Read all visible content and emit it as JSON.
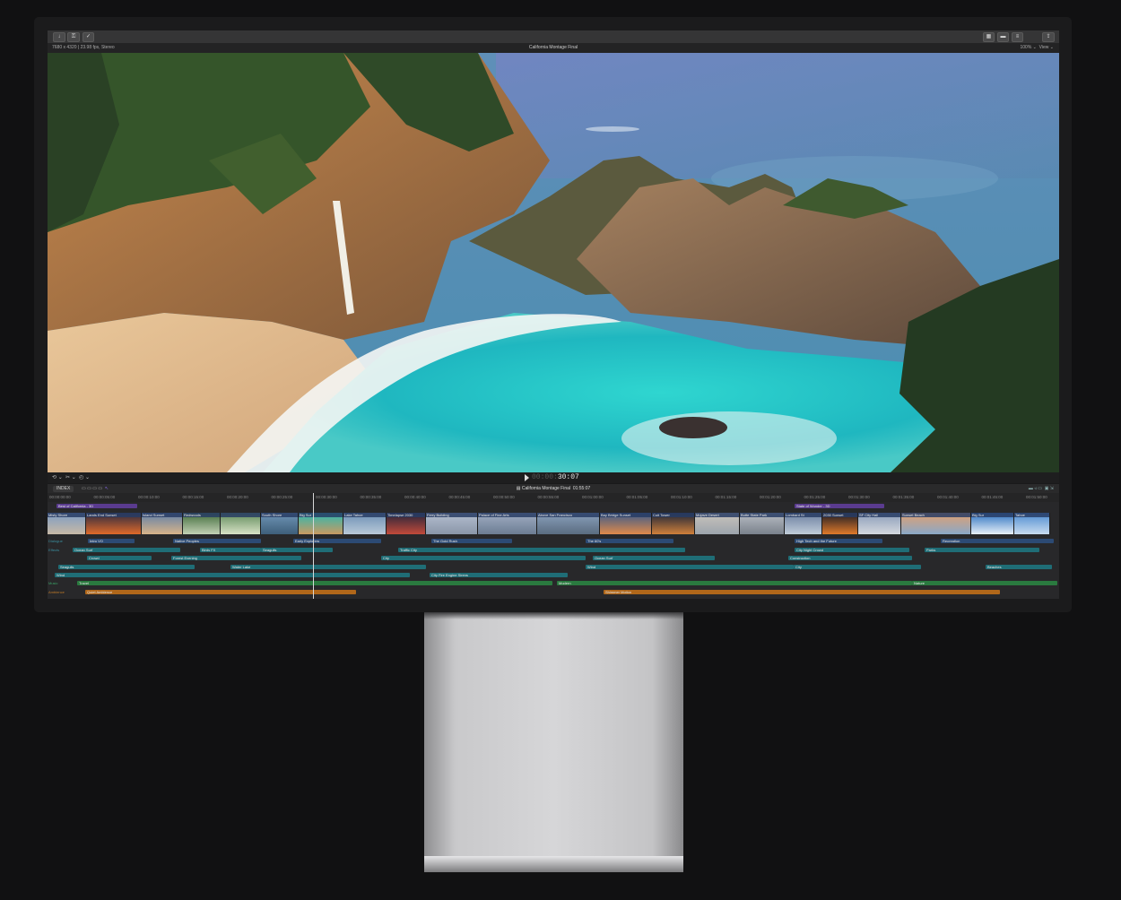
{
  "toolbar": {
    "import_icon": "download-icon",
    "keywords_icon": "key-icon",
    "background_tasks_icon": "checkmark-circle-icon",
    "share_icon": "share-icon"
  },
  "viewer": {
    "format_info": "7680 x 4320 | 23.98 fps, Stereo",
    "project_title": "California Montage Final",
    "zoom": "100%",
    "view_menu": "View"
  },
  "transport": {
    "timecode_dim": "00:00:",
    "timecode": "30:07"
  },
  "timeline": {
    "index_label": "INDEX",
    "project_label": "California Montage Final",
    "duration": "01:55:07",
    "ruler_ticks": [
      "00:00:00:00",
      "00:00:05:00",
      "00:00:10:00",
      "00:00:15:00",
      "00:00:20:00",
      "00:00:25:00",
      "00:00:30:00",
      "00:00:35:00",
      "00:00:40:00",
      "00:00:45:00",
      "00:00:50:00",
      "00:00:55:00",
      "00:01:00:00",
      "00:01:05:00",
      "00:01:10:00",
      "00:01:15:00",
      "00:01:20:00",
      "00:01:25:00",
      "00:01:30:00",
      "00:01:35:00",
      "00:01:40:00",
      "00:01:45:00",
      "00:01:50:00"
    ],
    "titles": [
      "Best of California - 3D",
      "State of Wonder - 3D"
    ],
    "clips": [
      "Misty Shore",
      "Lands End Sunset",
      "Island Sunset",
      "Redwoods",
      "",
      "South Shore",
      "Big Sur",
      "Lake Tahoe",
      "Timelapse 2030",
      "Ferry Building",
      "Palace of Fine Arts",
      "Above San Francisco",
      "Bay Bridge Sunset",
      "Coit Tower",
      "Mojave Desert",
      "Butte State Park",
      "Lombard St",
      "2030 Sunset",
      "SF City Hall",
      "Sunset Beach",
      "Big Sur",
      "Tahoe"
    ],
    "track_labels": {
      "dialogue": "Dialogue",
      "effects": "Effects",
      "music": "Music",
      "ambience": "Ambience"
    },
    "audio": {
      "dialogue": [
        "Intro VO",
        "Native Peoples",
        "Early Explorers",
        "The Gold Rush",
        "The 60's",
        "High Tech and the Future",
        "Recreation"
      ],
      "effects1": [
        "Ocean Surf",
        "Birds FX",
        "Seagulls",
        "Traffic City",
        "City Night Crowd",
        "Parks"
      ],
      "effects2": [
        "Crowd",
        "Forest Evening",
        "City",
        "Ocean Surf",
        "Construction"
      ],
      "effects3": [
        "Seagulls",
        "Water Lake",
        "Wind",
        "City",
        "Beaches"
      ],
      "effects4": [
        "Wind",
        "City Fire Engine Sirens"
      ],
      "music": [
        "Travel",
        "Modern",
        "Nature"
      ],
      "ambience": [
        "Quiet Ambience",
        "Shimmer Motion"
      ]
    }
  },
  "colors": {
    "title_purple": "#5a3b8f",
    "dialogue_blue": "#2c4a74",
    "effects_teal": "#1f6d76",
    "music_green": "#2a7a3f",
    "ambience_orange": "#b0671a"
  }
}
